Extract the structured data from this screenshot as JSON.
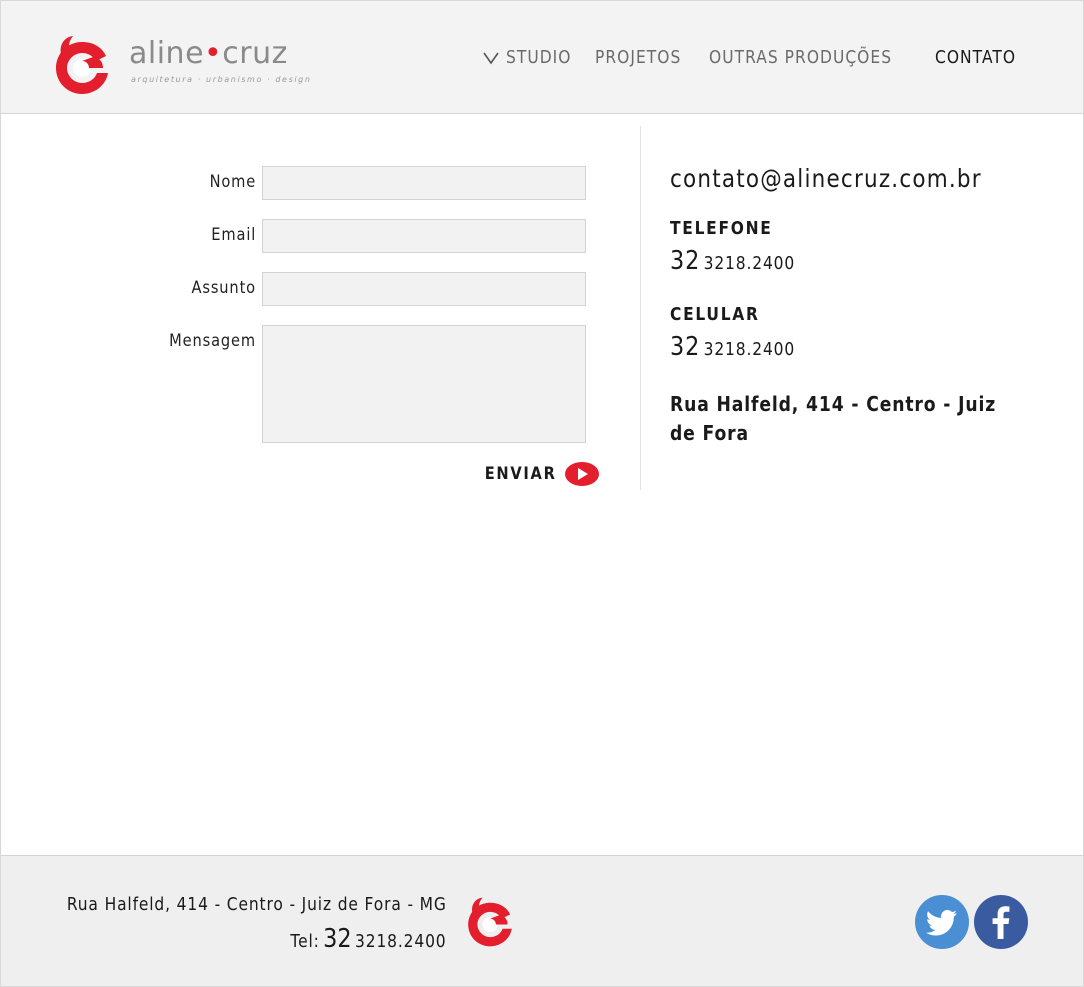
{
  "brand": {
    "name_part1": "aline",
    "name_dot": "•",
    "name_part2": "cruz",
    "tagline": "arquitetura · urbanismo · design",
    "accent_color": "#e31e2d"
  },
  "nav": {
    "chevron_icon": "chevron-down-icon",
    "items": [
      {
        "label": "STUDIO",
        "active": false
      },
      {
        "label": "PROJETOS",
        "active": false
      },
      {
        "label": "OUTRAS PRODUÇÕES",
        "active": false
      },
      {
        "label": "CONTATO",
        "active": true
      }
    ]
  },
  "form": {
    "name_label": "Nome",
    "email_label": "Email",
    "subject_label": "Assunto",
    "message_label": "Mensagem",
    "name_value": "",
    "email_value": "",
    "subject_value": "",
    "message_value": "",
    "submit_label": "ENVIAR",
    "submit_icon": "play-icon"
  },
  "contact": {
    "email": "contato@alinecruz.com.br",
    "phone_heading": "TELEFONE",
    "phone_area": "32",
    "phone_number": "3218.2400",
    "mobile_heading": "CELULAR",
    "mobile_area": "32",
    "mobile_number": "3218.2400",
    "address": "Rua Halfeld, 414 - Centro - Juiz de Fora"
  },
  "footer": {
    "address": "Rua Halfeld, 414 - Centro - Juiz de Fora - MG",
    "tel_label": "Tel:",
    "phone_area": "32",
    "phone_number": "3218.2400",
    "social": [
      {
        "name": "twitter",
        "icon": "twitter-icon",
        "color": "#4a8fd4"
      },
      {
        "name": "facebook",
        "icon": "facebook-icon",
        "color": "#3a5ba0"
      }
    ]
  }
}
